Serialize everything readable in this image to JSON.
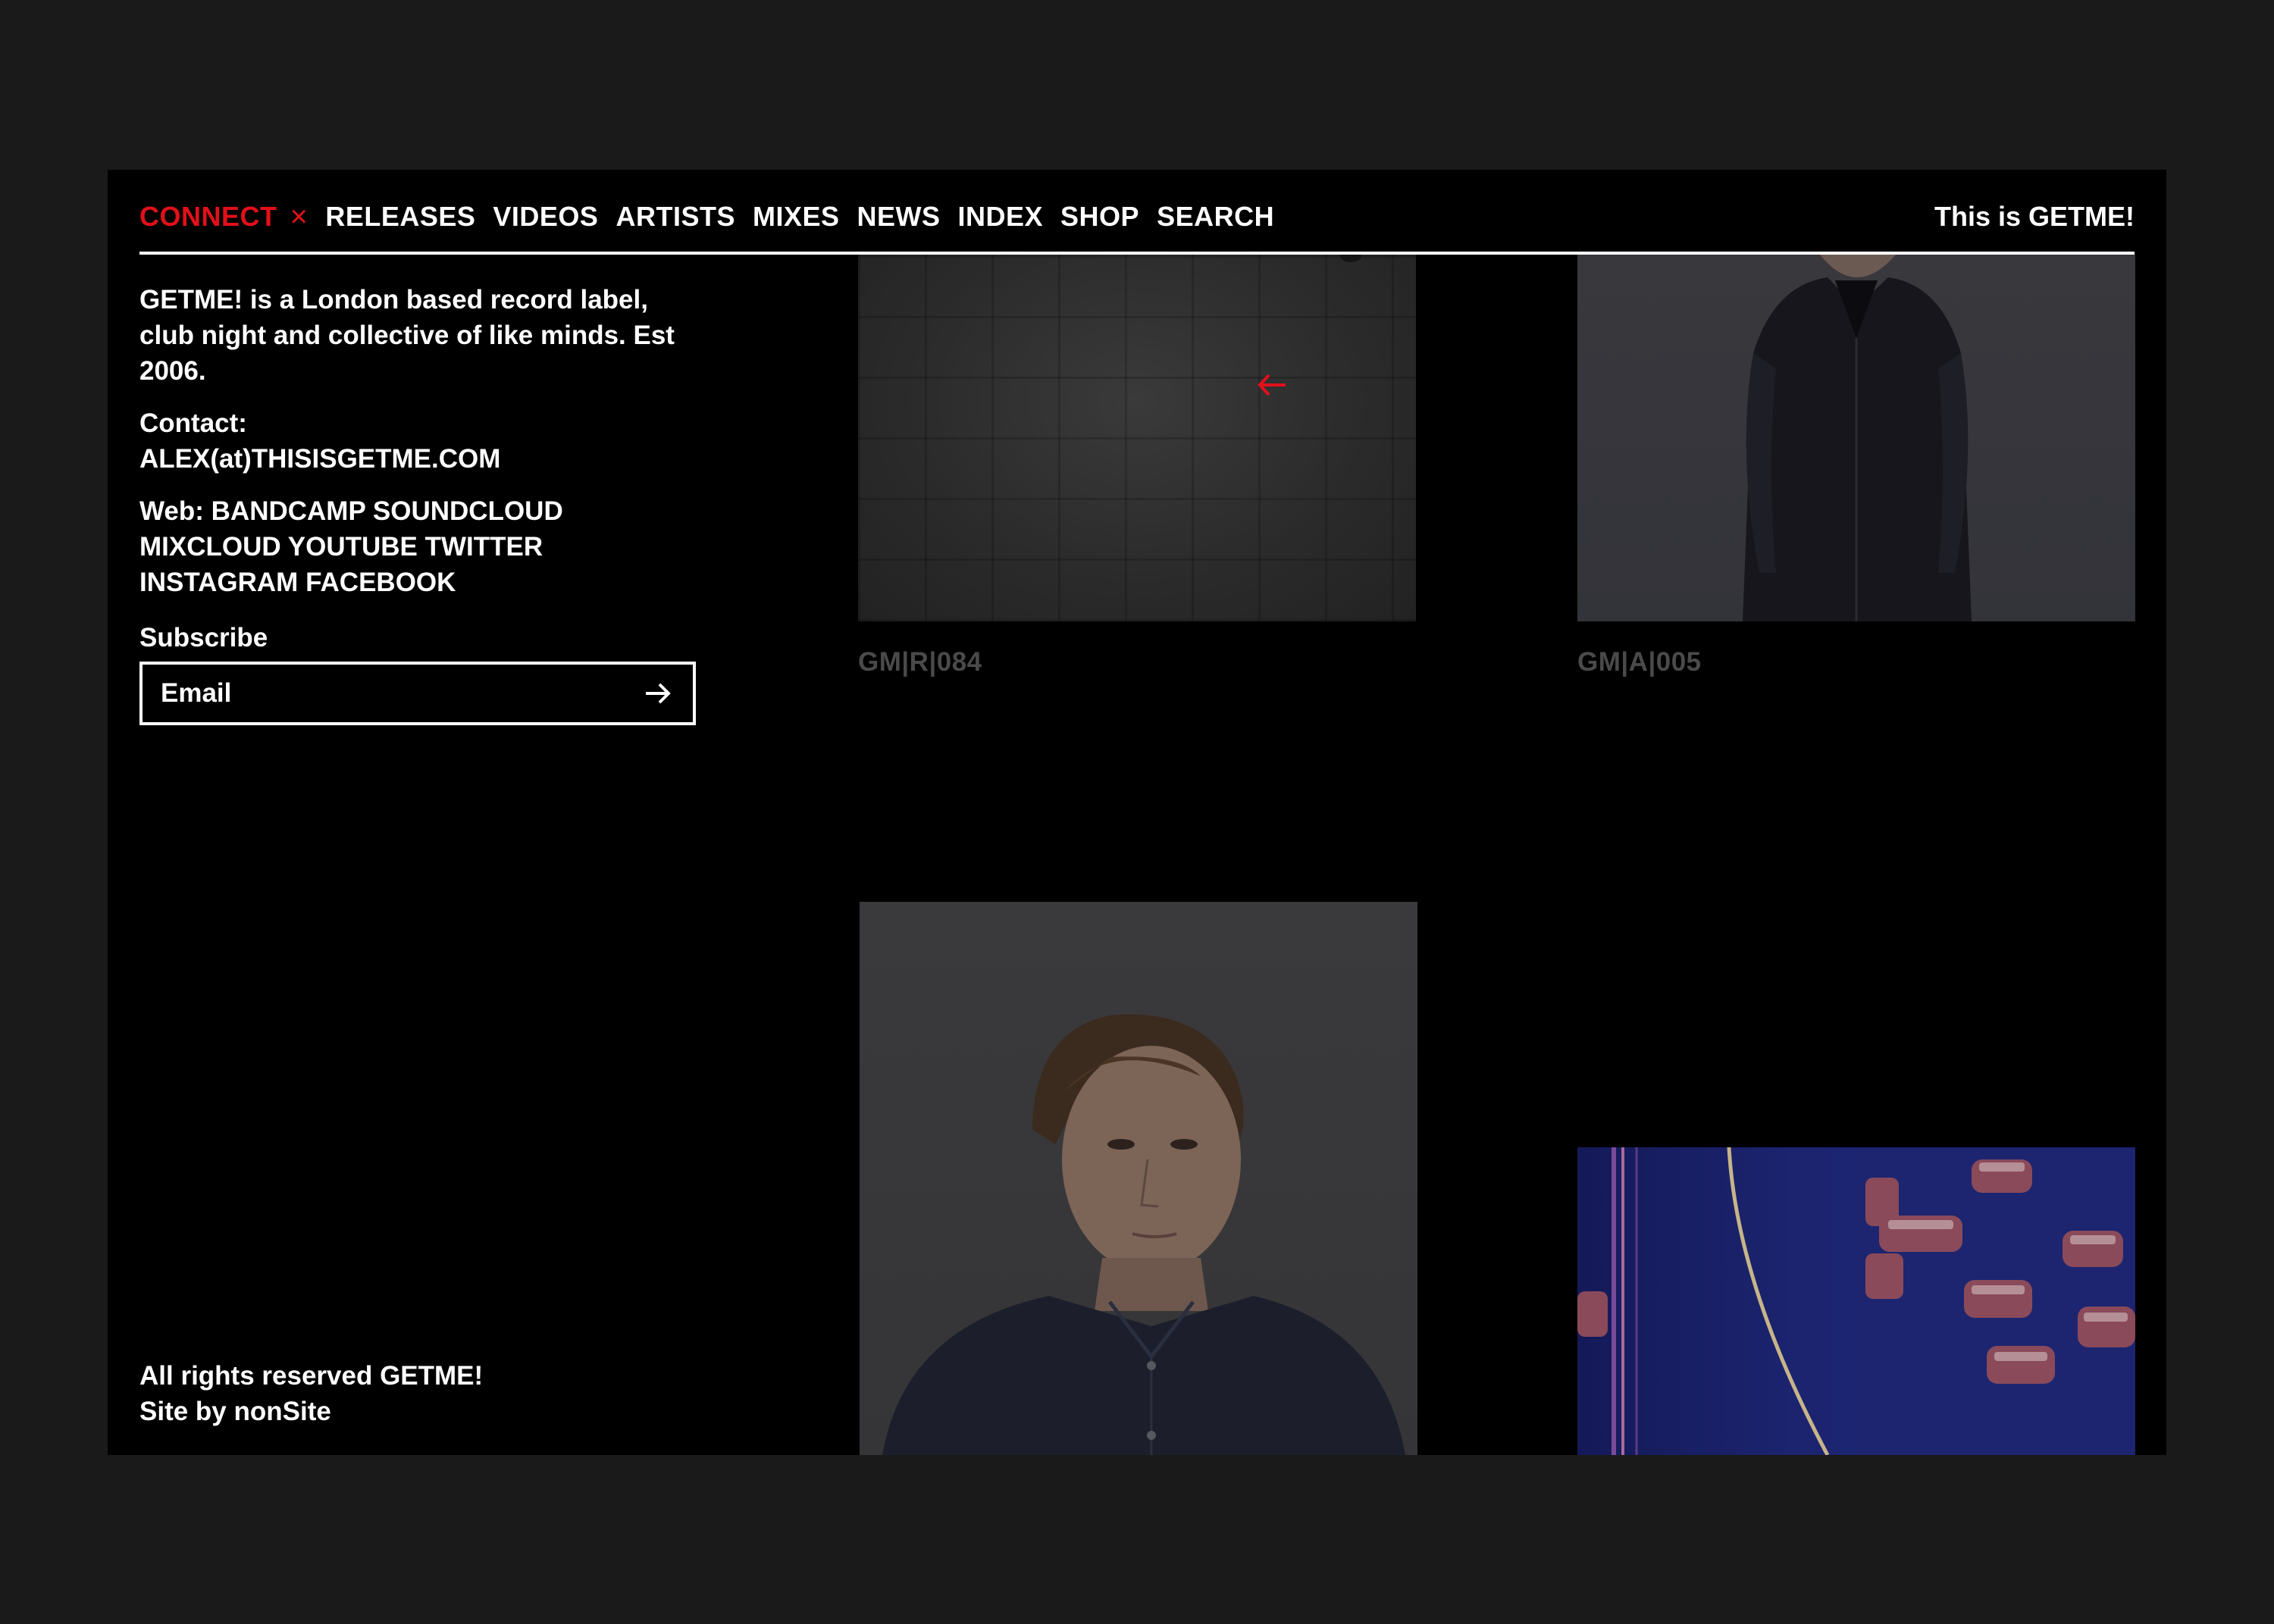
{
  "nav": {
    "items": [
      {
        "label": "CONNECT",
        "active": true
      },
      {
        "label": "RELEASES"
      },
      {
        "label": "VIDEOS"
      },
      {
        "label": "ARTISTS"
      },
      {
        "label": "MIXES"
      },
      {
        "label": "NEWS"
      },
      {
        "label": "INDEX"
      },
      {
        "label": "SHOP"
      },
      {
        "label": "SEARCH"
      }
    ],
    "close_icon": "×"
  },
  "brand": "This is GETME!",
  "connect": {
    "about": "GETME! is a London based record label, club night and collective of like minds. Est 2006.",
    "contact_label": "Contact:",
    "contact_email": "ALEX(at)THISISGETME.COM",
    "web_label": "Web:",
    "web_links": [
      "BANDCAMP",
      "SOUNDCLOUD",
      "MIXCLOUD",
      "YOUTUBE",
      "TWITTER",
      "INSTAGRAM",
      "FACEBOOK"
    ],
    "subscribe_label": "Subscribe",
    "email_placeholder": "Email"
  },
  "footer": {
    "rights": "All rights reserved GETME!",
    "credit_prefix": "Site by",
    "credit_name": "nonSite"
  },
  "grid": {
    "tiles": [
      {
        "code": "GM|R|084",
        "image": "tiled-floor-photo"
      },
      {
        "code": "GM|A|005",
        "image": "man-in-bomber-jacket-photo"
      },
      {
        "code": "",
        "image": "young-man-portrait-photo"
      },
      {
        "code": "",
        "image": "racing-cars-photo"
      }
    ]
  },
  "colors": {
    "background": "#1a1a1a",
    "panel": "#000000",
    "accent": "#e2101a",
    "text": "#ffffff",
    "muted": "#4a4a4a"
  },
  "icons": {
    "close": "close-icon",
    "submit": "arrow-right-icon",
    "hover": "arrow-left-icon"
  }
}
